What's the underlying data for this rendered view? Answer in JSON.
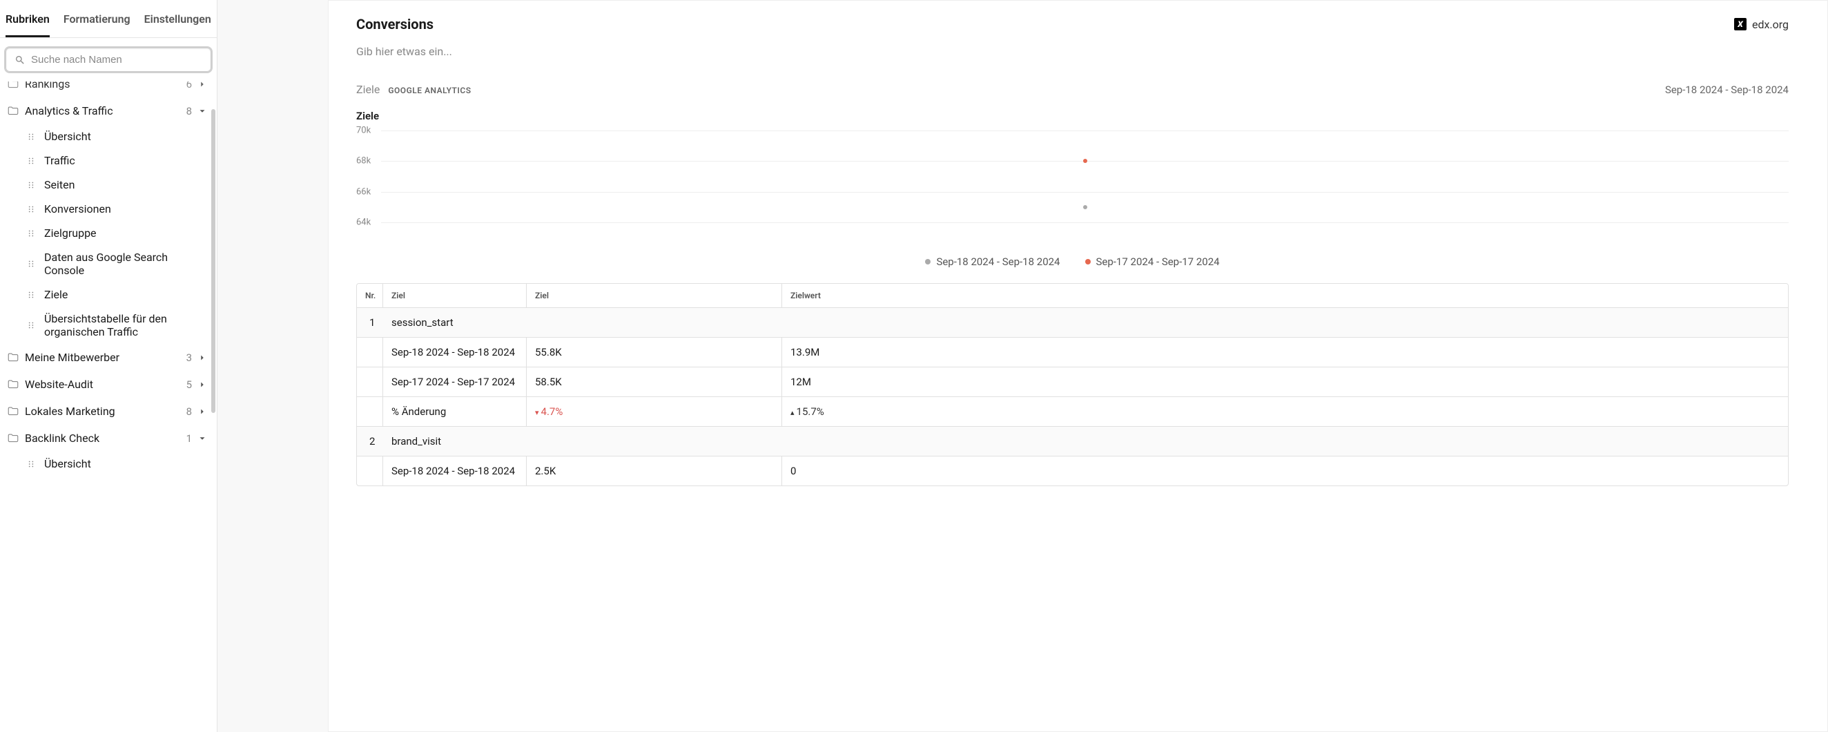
{
  "tabs": {
    "rubriken": "Rubriken",
    "formatierung": "Formatierung",
    "einstellungen": "Einstellungen"
  },
  "search": {
    "placeholder": "Suche nach Namen"
  },
  "sidebar": {
    "partialTop": {
      "label": "Rankings",
      "count": "6"
    },
    "groups": [
      {
        "label": "Analytics & Traffic",
        "count": "8",
        "open": true,
        "items": [
          "Übersicht",
          "Traffic",
          "Seiten",
          "Konversionen",
          "Zielgruppe",
          "Daten aus Google Search Console",
          "Ziele",
          "Übersichtstabelle für den organischen Traffic"
        ]
      },
      {
        "label": "Meine Mitbewerber",
        "count": "3",
        "open": false
      },
      {
        "label": "Website-Audit",
        "count": "5",
        "open": false
      },
      {
        "label": "Lokales Marketing",
        "count": "8",
        "open": false
      },
      {
        "label": "Backlink Check",
        "count": "1",
        "open": true,
        "items": [
          "Übersicht"
        ]
      }
    ]
  },
  "page": {
    "title": "Conversions",
    "subtitle": "Gib hier etwas ein...",
    "brand": "edx.org",
    "sectionLabel": "Ziele",
    "sectionBadge": "GOOGLE ANALYTICS",
    "dateRange": "Sep-18 2024 - Sep-18 2024",
    "chartTitle": "Ziele"
  },
  "chart_data": {
    "type": "scatter",
    "title": "Ziele",
    "ylabel": "",
    "ylim": [
      63000,
      70000
    ],
    "y_ticks": [
      "70k",
      "68k",
      "66k",
      "64k"
    ],
    "y_tick_values": [
      70000,
      68000,
      66000,
      64000
    ],
    "series": [
      {
        "name": "Sep-18 2024 - Sep-18 2024",
        "color": "#aaaaaa",
        "points": [
          {
            "x": 50,
            "y": 65000
          }
        ]
      },
      {
        "name": "Sep-17 2024 - Sep-17 2024",
        "color": "#e6684f",
        "points": [
          {
            "x": 50,
            "y": 68000
          }
        ]
      }
    ]
  },
  "table": {
    "headers": {
      "nr": "Nr.",
      "ziel": "Ziel",
      "zv": "Ziel",
      "zw": "Zielwert"
    },
    "changeLabel": "% Änderung",
    "periods": {
      "a": "Sep-18 2024 - Sep-18 2024",
      "b": "Sep-17 2024 - Sep-17 2024"
    },
    "rows": [
      {
        "nr": "1",
        "goal": "session_start",
        "a": {
          "ziel": "55.8K",
          "wert": "13.9M"
        },
        "b": {
          "ziel": "58.5K",
          "wert": "12M"
        },
        "change": {
          "ziel": "4.7%",
          "ziel_dir": "down",
          "wert": "15.7%",
          "wert_dir": "up"
        }
      },
      {
        "nr": "2",
        "goal": "brand_visit",
        "a": {
          "ziel": "2.5K",
          "wert": "0"
        }
      }
    ]
  }
}
